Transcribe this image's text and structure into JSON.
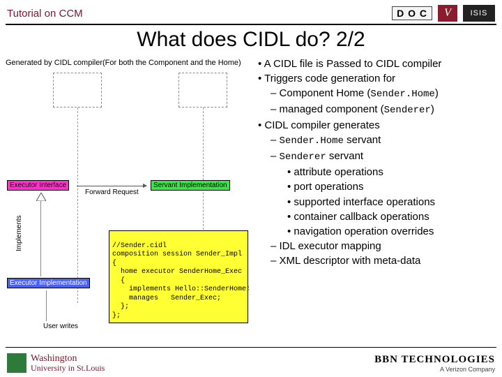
{
  "header": {
    "tutorial": "Tutorial on CCM",
    "logo_doc": "D O C",
    "logo_v": "V",
    "logo_isis": "ISIS"
  },
  "title": "What does CIDL do? 2/2",
  "diagram": {
    "gen_label": "Generated by CIDL compiler(For both the Component and the Home)",
    "executor_interface": "Executor Interface",
    "forward_request": "Forward Request",
    "servant_impl": "Servant Implementation",
    "implements": "Implements",
    "executor_impl": "Executor Implementation",
    "user_writes": "User writes",
    "cidl_comment": "//Sender.cidl",
    "cidl_l1": "composition session Sender_Impl",
    "cidl_l2": "{",
    "cidl_l3": "  home executor SenderHome_Exec",
    "cidl_l4": "  {",
    "cidl_l5": "    implements Hello::SenderHome;",
    "cidl_l6": "    manages   Sender_Exec;",
    "cidl_l7": "  };",
    "cidl_l8": "};"
  },
  "bullets": {
    "b1": "A CIDL file is Passed to CIDL compiler",
    "b2": "Triggers code generation for",
    "b2a_pre": "Component Home  (",
    "b2a_code": "Sender.Home",
    "b2a_post": ")",
    "b2b_pre": "managed component (",
    "b2b_code": "Senderer",
    "b2b_post": ")",
    "b3": "CIDL compiler generates",
    "b3a_code": "Sender.Home",
    "b3a_post": " servant",
    "b3b_code": "Senderer",
    "b3b_post": " servant",
    "b3b1": "attribute operations",
    "b3b2": "port operations",
    "b3b3": "supported interface operations",
    "b3b4": "container callback operations",
    "b3b5": "navigation operation overrides",
    "b4": "IDL executor mapping",
    "b5": "XML descriptor with meta-data"
  },
  "footer": {
    "wustl1": "Washington",
    "wustl2": "University in St.Louis",
    "bbn": "BBN TECHNOLOGIES",
    "bbn_sub": "A Verizon Company"
  }
}
